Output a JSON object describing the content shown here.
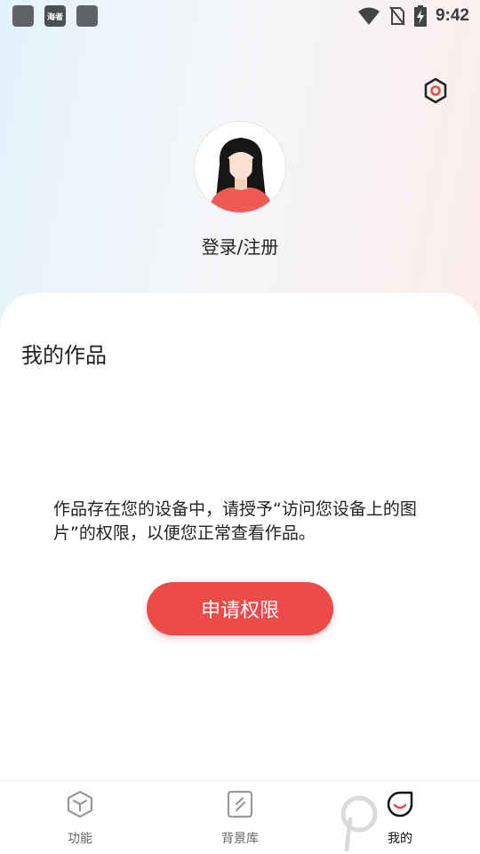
{
  "status_bar": {
    "time": "9:42",
    "notification_icons": [
      "app-icon",
      "haizhe-app-icon",
      "app-icon"
    ],
    "haizhe_label": "海者",
    "right_icons": [
      "wifi-icon",
      "no-sim-icon",
      "battery-charging-icon"
    ]
  },
  "header": {
    "settings_icon": "settings-icon",
    "login_label": "登录/注册"
  },
  "works": {
    "title": "我的作品",
    "permission_message": "作品存在您的设备中，请授予“访问您设备上的图片”的权限，以便您正常查看作品。",
    "request_button": "申请权限"
  },
  "bottom_nav": {
    "items": [
      {
        "label": "功能",
        "icon": "cube-icon",
        "active": false
      },
      {
        "label": "背景库",
        "icon": "background-library-icon",
        "active": false
      },
      {
        "label": "我的",
        "icon": "profile-icon",
        "active": true
      }
    ]
  },
  "colors": {
    "accent": "#ee4a4a",
    "text": "#222222",
    "nav_inactive": "#666666"
  }
}
